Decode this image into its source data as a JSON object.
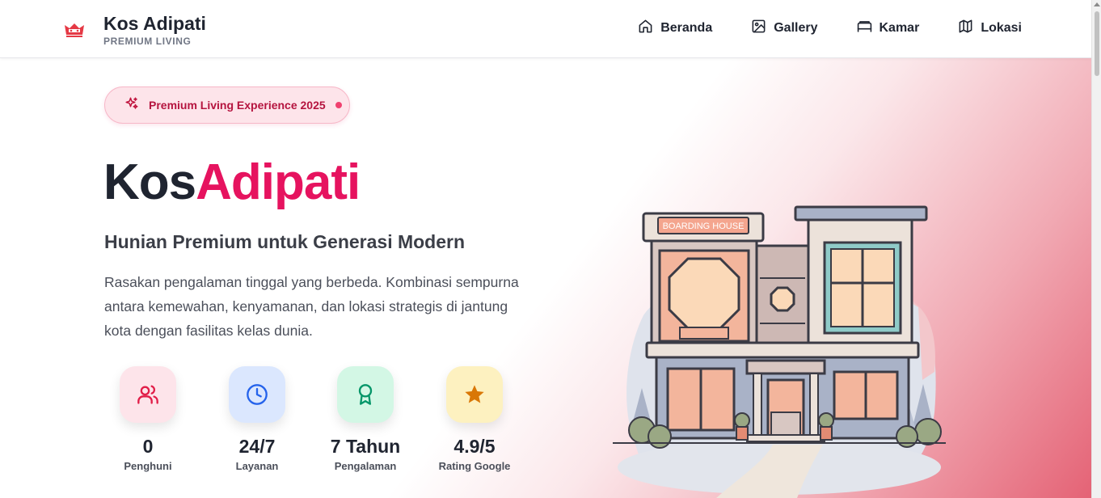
{
  "brand": {
    "name": "Kos Adipati",
    "tagline": "PREMIUM LIVING"
  },
  "nav": [
    {
      "label": "Beranda",
      "icon": "home-icon"
    },
    {
      "label": "Gallery",
      "icon": "image-icon"
    },
    {
      "label": "Kamar",
      "icon": "bed-icon"
    },
    {
      "label": "Lokasi",
      "icon": "map-icon"
    }
  ],
  "hero": {
    "badge": "Premium Living Experience 2025",
    "title_part1": "Kos",
    "title_part2": "Adipati",
    "subtitle": "Hunian Premium untuk Generasi Modern",
    "description": "Rasakan pengalaman tinggal yang berbeda. Kombinasi sempurna antara kemewahan, kenyamanan, dan lokasi strategis di jantung kota dengan fasilitas kelas dunia.",
    "illustration_sign": "BOARDING HOUSE"
  },
  "stats": [
    {
      "value": "0",
      "label": "Penghuni",
      "icon": "users-icon",
      "bg": "#fde4ea",
      "color": "#e11d48"
    },
    {
      "value": "24/7",
      "label": "Layanan",
      "icon": "clock-icon",
      "bg": "#dbe7fe",
      "color": "#2563eb"
    },
    {
      "value": "7 Tahun",
      "label": "Pengalaman",
      "icon": "award-icon",
      "bg": "#d3f7e5",
      "color": "#059669"
    },
    {
      "value": "4.9/5",
      "label": "Rating Google",
      "icon": "star-icon",
      "bg": "#fdf1c0",
      "color": "#d97706"
    }
  ],
  "colors": {
    "accent": "#e6135f",
    "text": "#1f2430",
    "badge_bg": "#fde4ea"
  }
}
